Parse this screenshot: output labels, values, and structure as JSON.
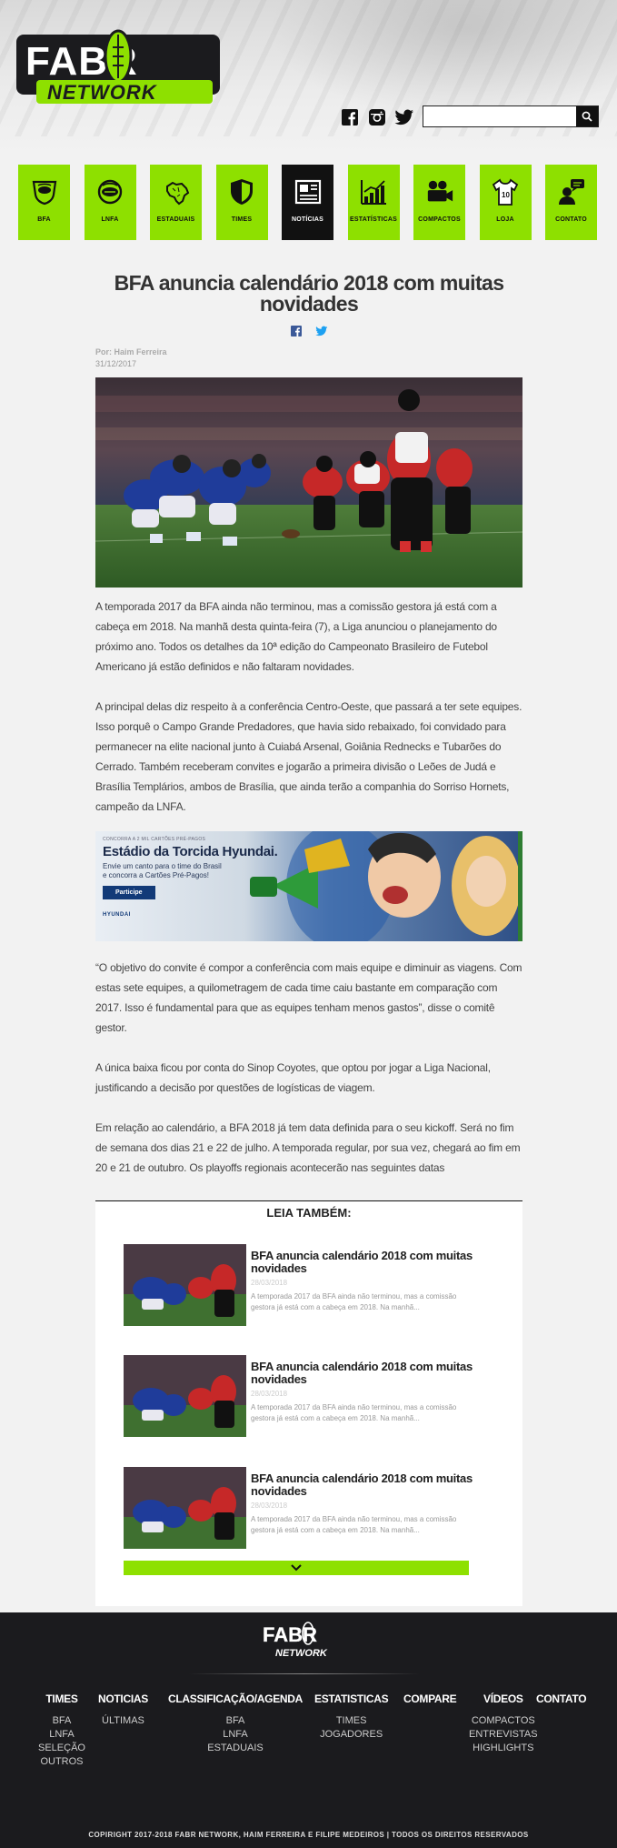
{
  "header": {
    "logo_text_top": "FABR",
    "logo_text_bottom": "NETWORK",
    "social": [
      "facebook-icon",
      "instagram-icon",
      "twitter-icon"
    ],
    "search_placeholder": "",
    "accent": "#8ee000"
  },
  "nav": {
    "items": [
      {
        "label": "BFA",
        "icon": "bfa-logo-icon",
        "active": false
      },
      {
        "label": "LNFA",
        "icon": "lnfa-logo-icon",
        "active": false
      },
      {
        "label": "ESTADUAIS",
        "icon": "brazil-map-icon",
        "active": false
      },
      {
        "label": "TIMES",
        "icon": "shield-icon",
        "active": false
      },
      {
        "label": "NOTÍCIAS",
        "icon": "newspaper-icon",
        "active": true
      },
      {
        "label": "ESTATÍSTICAS",
        "icon": "chart-icon",
        "active": false
      },
      {
        "label": "COMPACTOS",
        "icon": "camera-icon",
        "active": false
      },
      {
        "label": "LOJA",
        "icon": "jersey-icon",
        "active": false
      },
      {
        "label": "CONTATO",
        "icon": "contact-icon",
        "active": false
      }
    ]
  },
  "article": {
    "title": "BFA anuncia calendário 2018 com muitas novidades",
    "author": "Por: Haim Ferreira",
    "date": "31/12/2017",
    "paragraphs": [
      "A temporada 2017 da BFA ainda não terminou, mas a comissão gestora já está com a cabeça em 2018. Na manhã desta quinta-feira (7), a Liga anunciou o planejamento do próximo ano. Todos os detalhes da 10ª edição do Campeonato Brasileiro de Futebol Americano já estão definidos e não faltaram novidades.",
      "A principal delas diz respeito à a conferência Centro-Oeste, que passará a ter sete equipes. Isso porquê o Campo Grande Predadores, que havia sido rebaixado, foi convidado para permanecer na elite nacional junto à Cuiabá Arsenal, Goiânia Rednecks e Tubarões do Cerrado. Também receberam convites e jogarão a primeira divisão o Leões de Judá e Brasília Templários, ambos de Brasília, que ainda terão a companhia do Sorriso Hornets, campeão da LNFA.",
      "“O objetivo do convite é compor a conferência com mais equipe e diminuir as viagens. Com estas sete equipes, a quilometragem de cada time caiu bastante em comparação com 2017. Isso é fundamental para que as equipes tenham menos gastos”, disse o comitê gestor.",
      "A única baixa ficou por conta do Sinop Coyotes, que optou por jogar a Liga Nacional, justificando a decisão por questões de logísticas de viagem.",
      "Em relação ao calendário, a BFA 2018 já tem data definida para o seu kickoff. Será no fim de semana dos dias 21 e 22 de julho. A temporada regular, por sua vez, chegará ao fim em 20 e 21 de outubro.  Os playoffs regionais acontecerão nas seguintes datas"
    ]
  },
  "ad": {
    "small": "CONCORRA A 2 MIL CARTÕES PRÉ-PAGOS",
    "title": "Estádio da Torcida Hyundai.",
    "line1": "Envie um canto para o time do Brasil",
    "line2": "e concorra a Cartões Pré-Pagos!",
    "button": "Participe",
    "brand": "HYUNDAI"
  },
  "read_also": {
    "title": "LEIA TAMBÉM:",
    "items": [
      {
        "title": "BFA anuncia calendário 2018 com muitas novidades",
        "date": "28/03/2018",
        "excerpt": "A temporada 2017 da BFA ainda não terminou, mas a comissão gestora já está com a cabeça em 2018. Na manhã..."
      },
      {
        "title": "BFA anuncia calendário 2018 com muitas novidades",
        "date": "28/03/2018",
        "excerpt": "A temporada 2017 da BFA ainda não terminou, mas a comissão gestora já está com a cabeça em 2018. Na manhã..."
      },
      {
        "title": "BFA anuncia calendário 2018 com muitas novidades",
        "date": "28/03/2018",
        "excerpt": "A temporada 2017 da BFA ainda não terminou, mas a comissão gestora já está com a cabeça em 2018. Na manhã..."
      }
    ]
  },
  "footer": {
    "logo_top": "FABR",
    "logo_bottom": "NETWORK",
    "columns": [
      {
        "heading": "TIMES",
        "links": []
      },
      {
        "heading": "NOTICIAS",
        "links": [
          "ÚLTIMAS"
        ]
      },
      {
        "heading": "CLASSIFICAÇÃO/AGENDA",
        "links": [
          "BFA",
          "LNFA",
          "ESTADUAIS"
        ]
      },
      {
        "heading": "ESTATISTICAS",
        "links": [
          "TIMES",
          "JOGADORES"
        ]
      },
      {
        "heading": "COMPARE",
        "links": []
      },
      {
        "heading": "VÍDEOS",
        "links": [
          "COMPACTOS",
          "ENTREVISTAS",
          "HIGHLIGHTS"
        ]
      },
      {
        "heading": "CONTATO",
        "links": []
      }
    ],
    "times_links": [
      "BFA",
      "LNFA",
      "SELEÇÃO",
      "OUTROS"
    ],
    "copyright": "COPIRIGHT 2017-2018 FABR NETWORK, HAIM FERREIRA E FILIPE MEDEIROS | TODOS OS DIREITOS RESERVADOS"
  }
}
